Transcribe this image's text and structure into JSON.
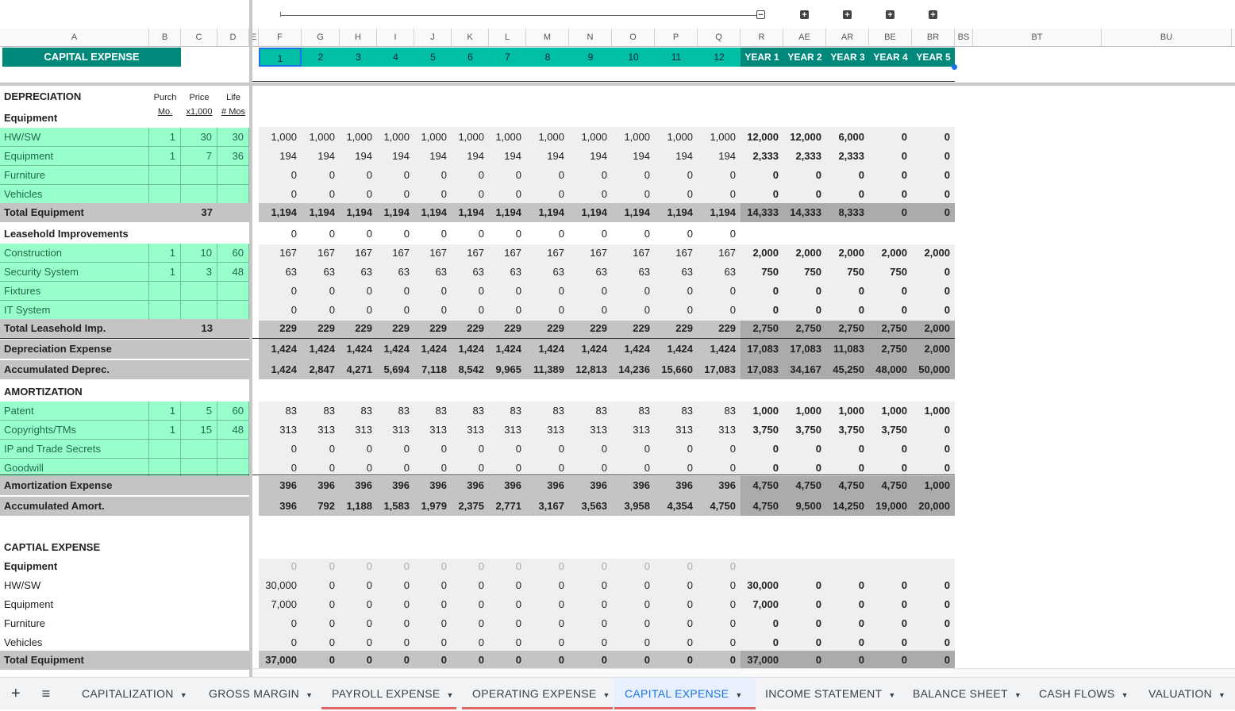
{
  "sheet": {
    "title_cell": "CAPITAL EXPENSE",
    "colors": {
      "teal": "#00bfa5",
      "dark_teal": "#00897b",
      "green_input": "#98ffcb",
      "grey_total": "#c4c4c4"
    }
  },
  "column_headers": [
    "A",
    "B",
    "C",
    "D",
    "E",
    "F",
    "G",
    "H",
    "I",
    "J",
    "K",
    "L",
    "M",
    "N",
    "O",
    "P",
    "Q",
    "R",
    "AE",
    "AR",
    "BE",
    "BR",
    "BS",
    "BT",
    "BU"
  ],
  "period_labels": [
    "1",
    "2",
    "3",
    "4",
    "5",
    "6",
    "7",
    "8",
    "9",
    "10",
    "11",
    "12",
    "YEAR 1",
    "YEAR 2",
    "YEAR 3",
    "YEAR 4",
    "YEAR 5"
  ],
  "depreciation_header": {
    "title": "DEPRECIATION",
    "purch": "Purch",
    "price": "Price",
    "life": "Life",
    "mo": "Mo.",
    "x1000": "x1,000",
    "mos": "# Mos"
  },
  "rows": [
    {
      "label": "Equipment",
      "style": "bold",
      "vals": []
    },
    {
      "label": "HW/SW",
      "style": "green",
      "b": "1",
      "c": "30",
      "d": "30",
      "vals": [
        "1,000",
        "1,000",
        "1,000",
        "1,000",
        "1,000",
        "1,000",
        "1,000",
        "1,000",
        "1,000",
        "1,000",
        "1,000",
        "1,000",
        "12,000",
        "12,000",
        "6,000",
        "0",
        "0"
      ]
    },
    {
      "label": "Equipment",
      "style": "green",
      "b": "1",
      "c": "7",
      "d": "36",
      "vals": [
        "194",
        "194",
        "194",
        "194",
        "194",
        "194",
        "194",
        "194",
        "194",
        "194",
        "194",
        "194",
        "2,333",
        "2,333",
        "2,333",
        "0",
        "0"
      ]
    },
    {
      "label": "Furniture",
      "style": "green",
      "vals": [
        "0",
        "0",
        "0",
        "0",
        "0",
        "0",
        "0",
        "0",
        "0",
        "0",
        "0",
        "0",
        "0",
        "0",
        "0",
        "0",
        "0"
      ]
    },
    {
      "label": "Vehicles",
      "style": "green",
      "vals": [
        "0",
        "0",
        "0",
        "0",
        "0",
        "0",
        "0",
        "0",
        "0",
        "0",
        "0",
        "0",
        "0",
        "0",
        "0",
        "0",
        "0"
      ]
    },
    {
      "label": "Total Equipment",
      "style": "total",
      "c": "37",
      "vals": [
        "1,194",
        "1,194",
        "1,194",
        "1,194",
        "1,194",
        "1,194",
        "1,194",
        "1,194",
        "1,194",
        "1,194",
        "1,194",
        "1,194",
        "14,333",
        "14,333",
        "8,333",
        "0",
        "0"
      ]
    },
    {
      "label": "Leasehold Improvements",
      "style": "bold",
      "vals": [
        "0",
        "0",
        "0",
        "0",
        "0",
        "0",
        "0",
        "0",
        "0",
        "0",
        "0",
        "0"
      ]
    },
    {
      "label": "Construction",
      "style": "green",
      "b": "1",
      "c": "10",
      "d": "60",
      "vals": [
        "167",
        "167",
        "167",
        "167",
        "167",
        "167",
        "167",
        "167",
        "167",
        "167",
        "167",
        "167",
        "2,000",
        "2,000",
        "2,000",
        "2,000",
        "2,000"
      ]
    },
    {
      "label": "Security System",
      "style": "green",
      "b": "1",
      "c": "3",
      "d": "48",
      "vals": [
        "63",
        "63",
        "63",
        "63",
        "63",
        "63",
        "63",
        "63",
        "63",
        "63",
        "63",
        "63",
        "750",
        "750",
        "750",
        "750",
        "0"
      ]
    },
    {
      "label": "Fixtures",
      "style": "green",
      "vals": [
        "0",
        "0",
        "0",
        "0",
        "0",
        "0",
        "0",
        "0",
        "0",
        "0",
        "0",
        "0",
        "0",
        "0",
        "0",
        "0",
        "0"
      ]
    },
    {
      "label": "IT System",
      "style": "green",
      "vals": [
        "0",
        "0",
        "0",
        "0",
        "0",
        "0",
        "0",
        "0",
        "0",
        "0",
        "0",
        "0",
        "0",
        "0",
        "0",
        "0",
        "0"
      ]
    },
    {
      "label": "Total Leasehold Imp.",
      "style": "total",
      "c": "13",
      "vals": [
        "229",
        "229",
        "229",
        "229",
        "229",
        "229",
        "229",
        "229",
        "229",
        "229",
        "229",
        "229",
        "2,750",
        "2,750",
        "2,750",
        "2,750",
        "2,000"
      ]
    },
    {
      "label": "Depreciation Expense",
      "style": "total",
      "vals": [
        "1,424",
        "1,424",
        "1,424",
        "1,424",
        "1,424",
        "1,424",
        "1,424",
        "1,424",
        "1,424",
        "1,424",
        "1,424",
        "1,424",
        "17,083",
        "17,083",
        "11,083",
        "2,750",
        "2,000"
      ]
    },
    {
      "label": "Accumulated Deprec.",
      "style": "total",
      "vals": [
        "1,424",
        "2,847",
        "4,271",
        "5,694",
        "7,118",
        "8,542",
        "9,965",
        "11,389",
        "12,813",
        "14,236",
        "15,660",
        "17,083",
        "17,083",
        "34,167",
        "45,250",
        "48,000",
        "50,000"
      ]
    },
    {
      "label": "AMORTIZATION",
      "style": "bold",
      "vals": []
    },
    {
      "label": "Patent",
      "style": "green",
      "b": "1",
      "c": "5",
      "d": "60",
      "vals": [
        "83",
        "83",
        "83",
        "83",
        "83",
        "83",
        "83",
        "83",
        "83",
        "83",
        "83",
        "83",
        "1,000",
        "1,000",
        "1,000",
        "1,000",
        "1,000"
      ]
    },
    {
      "label": "Copyrights/TMs",
      "style": "green",
      "b": "1",
      "c": "15",
      "d": "48",
      "vals": [
        "313",
        "313",
        "313",
        "313",
        "313",
        "313",
        "313",
        "313",
        "313",
        "313",
        "313",
        "313",
        "3,750",
        "3,750",
        "3,750",
        "3,750",
        "0"
      ]
    },
    {
      "label": "IP and Trade Secrets",
      "style": "green",
      "vals": [
        "0",
        "0",
        "0",
        "0",
        "0",
        "0",
        "0",
        "0",
        "0",
        "0",
        "0",
        "0",
        "0",
        "0",
        "0",
        "0",
        "0"
      ]
    },
    {
      "label": "Goodwill",
      "style": "green",
      "vals": [
        "0",
        "0",
        "0",
        "0",
        "0",
        "0",
        "0",
        "0",
        "0",
        "0",
        "0",
        "0",
        "0",
        "0",
        "0",
        "0",
        "0"
      ]
    },
    {
      "label": "Amortization Expense",
      "style": "total",
      "vals": [
        "396",
        "396",
        "396",
        "396",
        "396",
        "396",
        "396",
        "396",
        "396",
        "396",
        "396",
        "396",
        "4,750",
        "4,750",
        "4,750",
        "4,750",
        "1,000"
      ]
    },
    {
      "label": "Accumulated Amort.",
      "style": "total",
      "vals": [
        "396",
        "792",
        "1,188",
        "1,583",
        "1,979",
        "2,375",
        "2,771",
        "3,167",
        "3,563",
        "3,958",
        "4,354",
        "4,750",
        "4,750",
        "9,500",
        "14,250",
        "19,000",
        "20,000"
      ]
    },
    {
      "label": "",
      "style": "blank",
      "vals": []
    },
    {
      "label": "CAPTIAL EXPENSE",
      "style": "bold-plain",
      "vals": []
    },
    {
      "label": "Equipment",
      "style": "bold",
      "vals": [
        "0",
        "0",
        "0",
        "0",
        "0",
        "0",
        "0",
        "0",
        "0",
        "0",
        "0",
        "0"
      ]
    },
    {
      "label": "HW/SW",
      "style": "plain",
      "vals": [
        "30,000",
        "0",
        "0",
        "0",
        "0",
        "0",
        "0",
        "0",
        "0",
        "0",
        "0",
        "0",
        "30,000",
        "0",
        "0",
        "0",
        "0"
      ]
    },
    {
      "label": "Equipment",
      "style": "plain",
      "vals": [
        "7,000",
        "0",
        "0",
        "0",
        "0",
        "0",
        "0",
        "0",
        "0",
        "0",
        "0",
        "0",
        "7,000",
        "0",
        "0",
        "0",
        "0"
      ]
    },
    {
      "label": "Furniture",
      "style": "plain",
      "vals": [
        "0",
        "0",
        "0",
        "0",
        "0",
        "0",
        "0",
        "0",
        "0",
        "0",
        "0",
        "0",
        "0",
        "0",
        "0",
        "0",
        "0"
      ]
    },
    {
      "label": "Vehicles",
      "style": "plain",
      "vals": [
        "0",
        "0",
        "0",
        "0",
        "0",
        "0",
        "0",
        "0",
        "0",
        "0",
        "0",
        "0",
        "0",
        "0",
        "0",
        "0",
        "0"
      ]
    },
    {
      "label": "Total Equipment",
      "style": "total",
      "vals": [
        "37,000",
        "0",
        "0",
        "0",
        "0",
        "0",
        "0",
        "0",
        "0",
        "0",
        "0",
        "0",
        "37,000",
        "0",
        "0",
        "0",
        "0"
      ]
    }
  ],
  "tabs": [
    {
      "label": "CAPITALIZATION",
      "active": false,
      "stripe": ""
    },
    {
      "label": "GROSS MARGIN",
      "active": false,
      "stripe": ""
    },
    {
      "label": "PAYROLL EXPENSE",
      "active": false,
      "stripe": "#e06666"
    },
    {
      "label": "OPERATING EXPENSE",
      "active": false,
      "stripe": "#e06666"
    },
    {
      "label": "CAPITAL EXPENSE",
      "active": true,
      "stripe": "#e06666"
    },
    {
      "label": "INCOME STATEMENT",
      "active": false,
      "stripe": ""
    },
    {
      "label": "BALANCE SHEET",
      "active": false,
      "stripe": ""
    },
    {
      "label": "CASH FLOWS",
      "active": false,
      "stripe": ""
    },
    {
      "label": "VALUATION",
      "active": false,
      "stripe": ""
    }
  ],
  "icons": {
    "add_sheet": "plus-icon",
    "all_sheets": "menu-icon",
    "group_expand": "plus-box-icon",
    "group_collapse": "minus-box-icon"
  }
}
